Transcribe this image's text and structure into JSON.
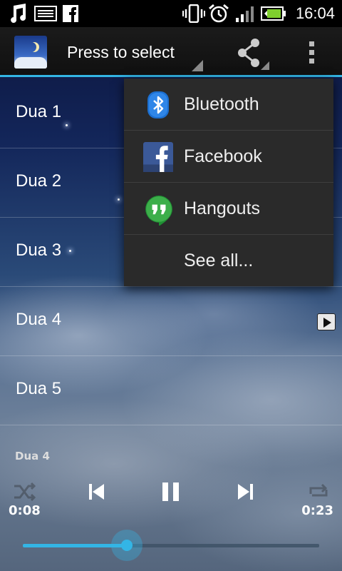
{
  "status_bar": {
    "time": "16:04",
    "battery_level": 0.9,
    "left_icons": [
      "music-note-icon",
      "image-icon",
      "facebook-icon"
    ],
    "right_icons": [
      "vibrate-icon",
      "alarm-icon",
      "signal-icon",
      "battery-icon"
    ]
  },
  "action_bar": {
    "title": "Press to select",
    "share_icon": "share-icon",
    "overflow_icon": "overflow-menu-icon"
  },
  "list": {
    "items": [
      {
        "label": "Dua 1"
      },
      {
        "label": "Dua 2"
      },
      {
        "label": "Dua 3"
      },
      {
        "label": "Dua 4",
        "playing": true
      },
      {
        "label": "Dua 5"
      }
    ]
  },
  "share_menu": {
    "items": [
      {
        "label": "Bluetooth",
        "icon": "bluetooth-icon"
      },
      {
        "label": "Facebook",
        "icon": "facebook-icon"
      },
      {
        "label": "Hangouts",
        "icon": "hangouts-icon"
      },
      {
        "label": "See all..."
      }
    ]
  },
  "player": {
    "now_playing": "Dua 4",
    "elapsed": "0:08",
    "duration": "0:23",
    "progress_fraction": 0.35
  },
  "colors": {
    "accent": "#33b5e5",
    "menu_background": "#2a2a2a",
    "status_bar": "#000000"
  }
}
